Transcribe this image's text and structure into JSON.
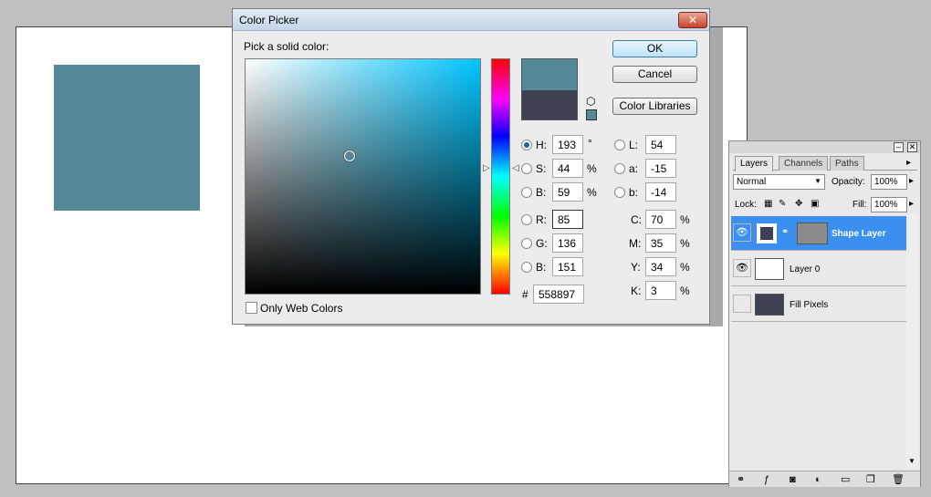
{
  "dialog": {
    "title": "Color Picker",
    "close_label": "✕",
    "instruction": "Pick a solid color:",
    "ok_label": "OK",
    "cancel_label": "Cancel",
    "libraries_label": "Color Libraries",
    "only_web_colors_label": "Only Web Colors",
    "hsb": {
      "h_label": "H:",
      "h_value": "193",
      "h_unit": "°",
      "s_label": "S:",
      "s_value": "44",
      "s_unit": "%",
      "b_label": "B:",
      "b_value": "59",
      "b_unit": "%"
    },
    "rgb": {
      "r_label": "R:",
      "r_value": "85",
      "g_label": "G:",
      "g_value": "136",
      "b_label": "B:",
      "b_value": "151"
    },
    "lab": {
      "l_label": "L:",
      "l_value": "54",
      "a_label": "a:",
      "a_value": "-15",
      "b_label": "b:",
      "b_value": "-14"
    },
    "cmyk": {
      "c_label": "C:",
      "c_value": "70",
      "m_label": "M:",
      "m_value": "35",
      "y_label": "Y:",
      "y_value": "34",
      "k_label": "K:",
      "k_value": "3",
      "unit": "%"
    },
    "hex_label": "#",
    "hex_value": "558897",
    "new_color": "#558897",
    "old_color": "#3d4153"
  },
  "layers_panel": {
    "tabs": [
      "Layers",
      "Channels",
      "Paths"
    ],
    "blend_mode": "Normal",
    "opacity_label": "Opacity:",
    "opacity_value": "100%",
    "lock_label": "Lock:",
    "fill_label": "Fill:",
    "fill_value": "100%",
    "layers": [
      {
        "name": "Shape Layer"
      },
      {
        "name": "Layer 0"
      },
      {
        "name": "Fill Pixels"
      }
    ]
  },
  "canvas": {
    "swatch_color": "#558897"
  }
}
